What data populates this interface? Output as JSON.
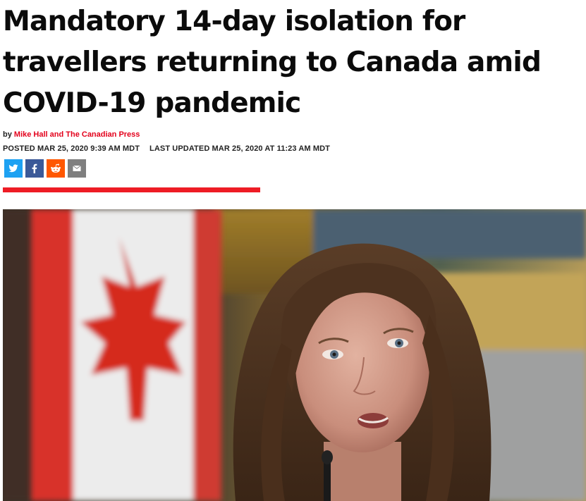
{
  "article": {
    "headline": "Mandatory 14-day isolation for travellers returning to Canada amid COVID-19 pandemic",
    "byline_prefix": "by ",
    "author": "Mike Hall and The Canadian Press",
    "posted": "POSTED MAR 25, 2020 9:39 AM MDT",
    "updated": "LAST UPDATED MAR 25, 2020 AT 11:23 AM MDT"
  },
  "share": [
    {
      "name": "twitter-share-button",
      "icon": "twitter-icon",
      "color": "#1da1f2"
    },
    {
      "name": "facebook-share-button",
      "icon": "facebook-icon",
      "color": "#3b5998"
    },
    {
      "name": "reddit-share-button",
      "icon": "reddit-icon",
      "color": "#ff5700"
    },
    {
      "name": "email-share-button",
      "icon": "email-icon",
      "color": "#7f7f7f"
    }
  ],
  "colors": {
    "accent": "#ee1c25",
    "author_link": "#e3001b"
  },
  "photo": {
    "subject": "woman-speaking-photo",
    "background": "canadian-flag"
  }
}
